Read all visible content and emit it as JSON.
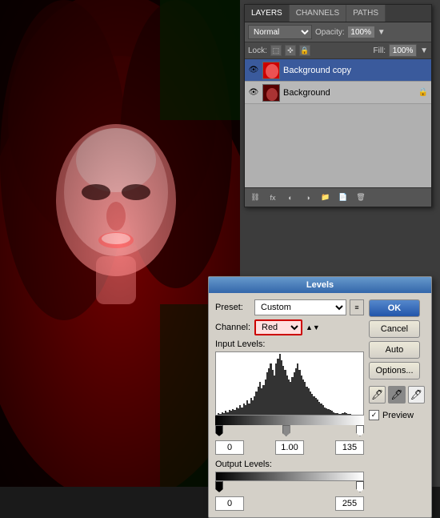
{
  "mainImage": {
    "description": "Red portrait photo"
  },
  "layersPanel": {
    "title": "Layers Panel",
    "tabs": [
      {
        "label": "LAYERS",
        "active": true
      },
      {
        "label": "CHANNELS",
        "active": false
      },
      {
        "label": "PATHS",
        "active": false
      }
    ],
    "blendMode": "Normal",
    "opacity": "100%",
    "fill": "100%",
    "lockLabel": "Lock:",
    "layers": [
      {
        "name": "Background copy",
        "active": true,
        "hasLock": false
      },
      {
        "name": "Background",
        "active": false,
        "hasLock": true
      }
    ],
    "bottomIcons": [
      "link",
      "fx",
      "mask",
      "adjustment",
      "group",
      "new",
      "trash"
    ]
  },
  "levelsDialog": {
    "title": "Levels",
    "presetLabel": "Preset:",
    "presetValue": "Custom",
    "channelLabel": "Channel:",
    "channelValue": "Red",
    "inputLevelsLabel": "Input Levels:",
    "inputValues": [
      "0",
      "1.00",
      "135"
    ],
    "outputLevelsLabel": "Output Levels:",
    "outputValues": [
      "0",
      "255"
    ],
    "buttons": {
      "ok": "OK",
      "cancel": "Cancel",
      "auto": "Auto",
      "options": "Options..."
    },
    "previewLabel": "Preview",
    "previewChecked": true,
    "histogram": [
      2,
      1,
      3,
      2,
      4,
      3,
      5,
      4,
      6,
      5,
      8,
      7,
      10,
      8,
      12,
      10,
      15,
      12,
      18,
      15,
      20,
      25,
      30,
      35,
      28,
      32,
      38,
      45,
      50,
      55,
      48,
      42,
      55,
      60,
      65,
      58,
      52,
      48,
      42,
      38,
      35,
      40,
      45,
      50,
      55,
      48,
      42,
      38,
      35,
      30,
      28,
      25,
      22,
      20,
      18,
      16,
      14,
      12,
      10,
      8,
      7,
      6,
      5,
      4,
      3,
      2,
      2,
      1,
      1,
      2,
      3,
      2,
      1,
      1,
      0,
      0,
      0,
      0,
      0,
      0
    ]
  }
}
